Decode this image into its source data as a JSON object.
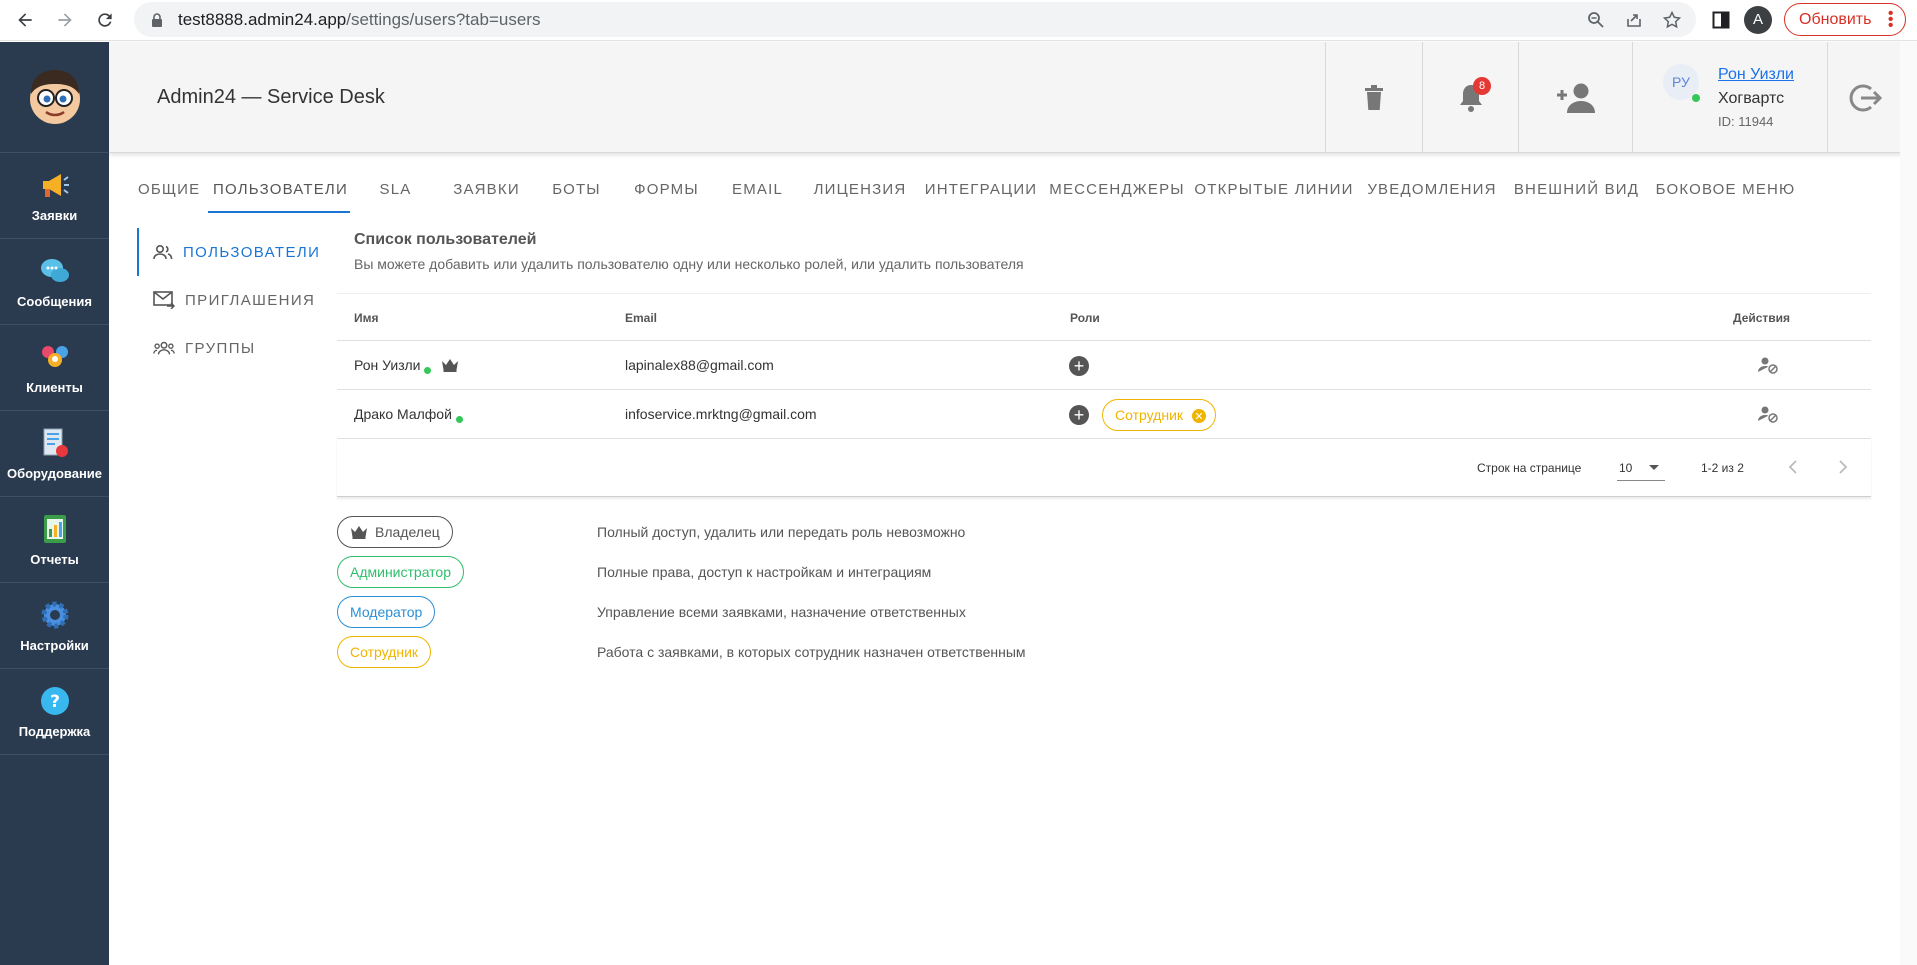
{
  "browser": {
    "url_host": "test8888.admin24.app",
    "url_path": "/settings/users?tab=users",
    "profile_initial": "A",
    "update_label": "Обновить"
  },
  "sidebar": {
    "items": [
      {
        "label": "Заявки",
        "icon": "megaphone-icon"
      },
      {
        "label": "Сообщения",
        "icon": "chat-bubbles-icon"
      },
      {
        "label": "Клиенты",
        "icon": "clients-icon"
      },
      {
        "label": "Оборудование",
        "icon": "equipment-icon"
      },
      {
        "label": "Отчеты",
        "icon": "reports-icon"
      },
      {
        "label": "Настройки",
        "icon": "gear-icon"
      },
      {
        "label": "Поддержка",
        "icon": "help-icon"
      }
    ]
  },
  "header": {
    "title": "Admin24 — Service Desk",
    "notifications_count": "8",
    "user": {
      "initials": "РУ",
      "name": "Рон Уизли",
      "org": "Хогвартс",
      "id": "ID: 11944"
    }
  },
  "tabs": [
    {
      "label": "Общие"
    },
    {
      "label": "Пользователи"
    },
    {
      "label": "SLA"
    },
    {
      "label": "Заявки"
    },
    {
      "label": "Боты"
    },
    {
      "label": "Формы"
    },
    {
      "label": "Email"
    },
    {
      "label": "Лицензия"
    },
    {
      "label": "Интеграции"
    },
    {
      "label": "Мессенджеры"
    },
    {
      "label": "Открытые линии"
    },
    {
      "label": "Уведомления"
    },
    {
      "label": "Внешний вид"
    },
    {
      "label": "Боковое меню"
    }
  ],
  "subnav": [
    {
      "label": "ПОЛЬЗОВАТЕЛИ"
    },
    {
      "label": "ПРИГЛАШЕНИЯ"
    },
    {
      "label": "ГРУППЫ"
    }
  ],
  "users_list": {
    "title": "Список пользователей",
    "subtitle": "Вы можете добавить или удалить пользователю одну или несколько ролей, или удалить пользователя",
    "columns": {
      "name": "Имя",
      "email": "Email",
      "roles": "Роли",
      "actions": "Действия"
    },
    "rows": [
      {
        "name": "Рон Уизли",
        "email": "lapinalex88@gmail.com",
        "role": ""
      },
      {
        "name": "Драко Малфой",
        "email": "infoservice.mrktng@gmail.com",
        "role": "Сотрудник"
      }
    ],
    "pagination": {
      "rows_per_page_label": "Строк на странице",
      "rows_per_page": "10",
      "range": "1-2 из 2"
    }
  },
  "legend": [
    {
      "role": "Владелец",
      "color": "#555555",
      "description": "Полный доступ, удалить или передать роль невозможно"
    },
    {
      "role": "Администратор",
      "color": "#2ebd6b",
      "description": "Полные права, доступ к настройкам и интеграциям"
    },
    {
      "role": "Модератор",
      "color": "#2a8fd6",
      "description": "Управление всеми заявками, назначение ответственных"
    },
    {
      "role": "Сотрудник",
      "color": "#f0b400",
      "description": "Работа с заявками, в которых сотрудник назначен ответственным"
    }
  ]
}
